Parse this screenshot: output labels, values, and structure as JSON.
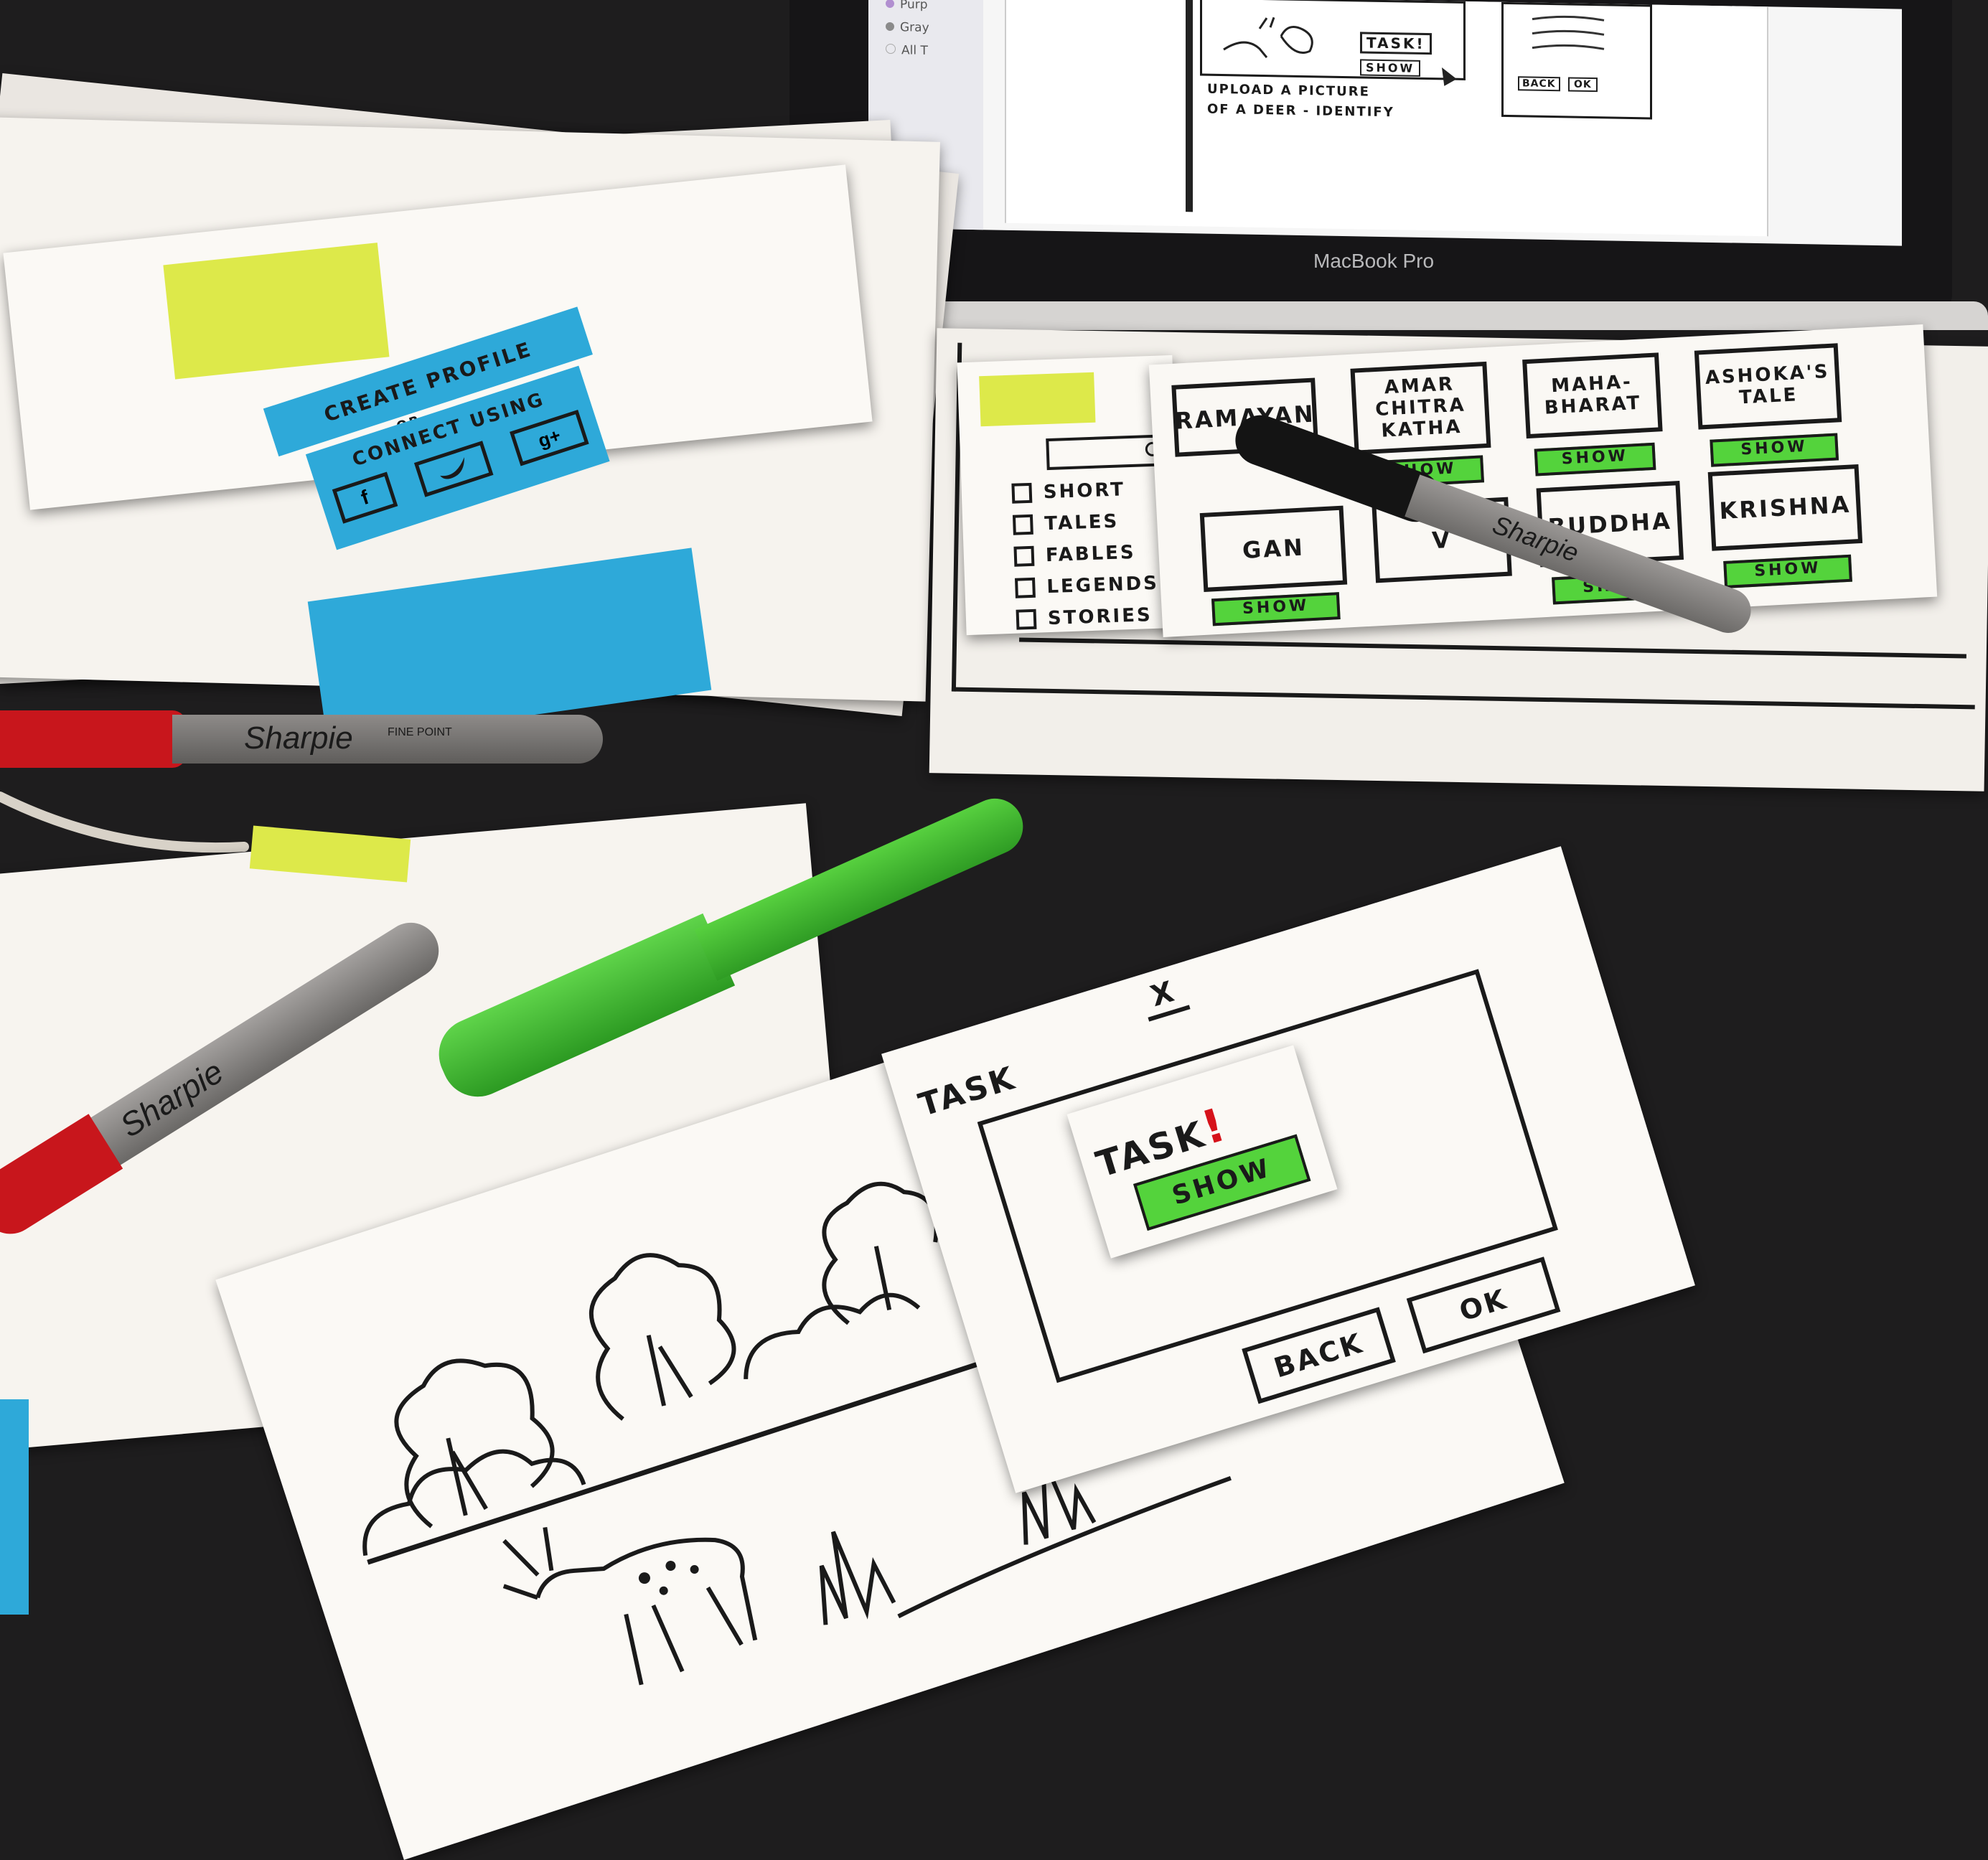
{
  "laptop": {
    "brand": "MacBook Pro",
    "screen": {
      "sidebar_items": [
        "Purp",
        "Gray",
        "All T"
      ],
      "sketch_task": "TASK!",
      "sketch_show": "SHOW",
      "sketch_caption_line1": "UPLOAD A PICTURE",
      "sketch_caption_line2": "OF A DEER - IDENTIFY",
      "sketch_back": "BACK",
      "sketch_ok": "OK"
    }
  },
  "profile_card": {
    "title_line1": "CREATE PROFILE",
    "title_line2": "OR",
    "title_line3": "CONNECT USING",
    "social_buttons": [
      "f",
      "twitter",
      "g+"
    ]
  },
  "story_grid": {
    "filters": [
      "SHORT",
      "TALES",
      "FABLES",
      "LEGENDS",
      "STORIES"
    ],
    "cards_row1": [
      {
        "title": "RAMAYAN",
        "show": ""
      },
      {
        "title": "AMAR CHITRA KATHA",
        "show": "SHOW"
      },
      {
        "title": "MAHA- BHARAT",
        "show": "SHOW"
      },
      {
        "title": "ASHOKA'S TALE",
        "show": "SHOW"
      }
    ],
    "cards_row2": [
      {
        "title": "GAN",
        "show": "SHOW"
      },
      {
        "title": "V",
        "show": ""
      },
      {
        "title": "BUDDHA",
        "show": "SHOW"
      },
      {
        "title": "KRISHNA",
        "show": "SHOW"
      }
    ]
  },
  "task_card": {
    "header": "TASK",
    "close": "x",
    "back": "BACK",
    "ok": "OK"
  },
  "task_popup": {
    "title": "TASK",
    "exclaim": "!",
    "show": "SHOW"
  },
  "markers": {
    "red_brand": "Sharpie",
    "red_sub": "FINE POINT",
    "gray_brand": "Sharpie",
    "black_brand": "Sharpie"
  },
  "colors": {
    "sticky_yellow": "#dde94a",
    "sticky_blue": "#2ea9d9",
    "show_green": "#54d33c",
    "marker_red": "#c8161c",
    "marker_green": "#3fc232"
  }
}
